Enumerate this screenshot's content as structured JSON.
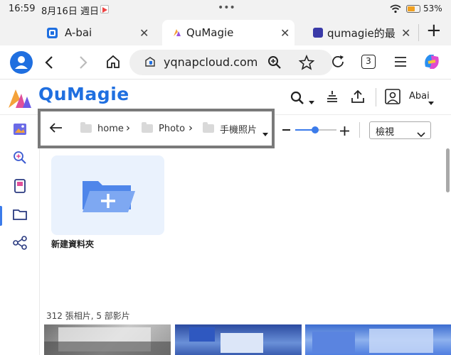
{
  "status": {
    "time": "16:59",
    "date": "8月16日 週日",
    "dots": "•••",
    "battery": "53%"
  },
  "tabs": [
    {
      "label": "A-bai",
      "close": "✕"
    },
    {
      "label": "QuMagie",
      "close": "✕"
    },
    {
      "label": "qumagie的最",
      "close": "✕"
    }
  ],
  "newtab": "+",
  "url": "yqnapcloud.com",
  "tab_count": "3",
  "app": {
    "logo_text": "QuMagie",
    "user": "Abai"
  },
  "breadcrumb": {
    "items": [
      "home",
      "Photo",
      "手機照片"
    ]
  },
  "view_select": "檢視",
  "new_folder_label": "新建資料夾",
  "media_count": "312 張相片, 5 部影片",
  "colors": {
    "accent": "#3b7bea",
    "folder": "#6fa0f0"
  }
}
